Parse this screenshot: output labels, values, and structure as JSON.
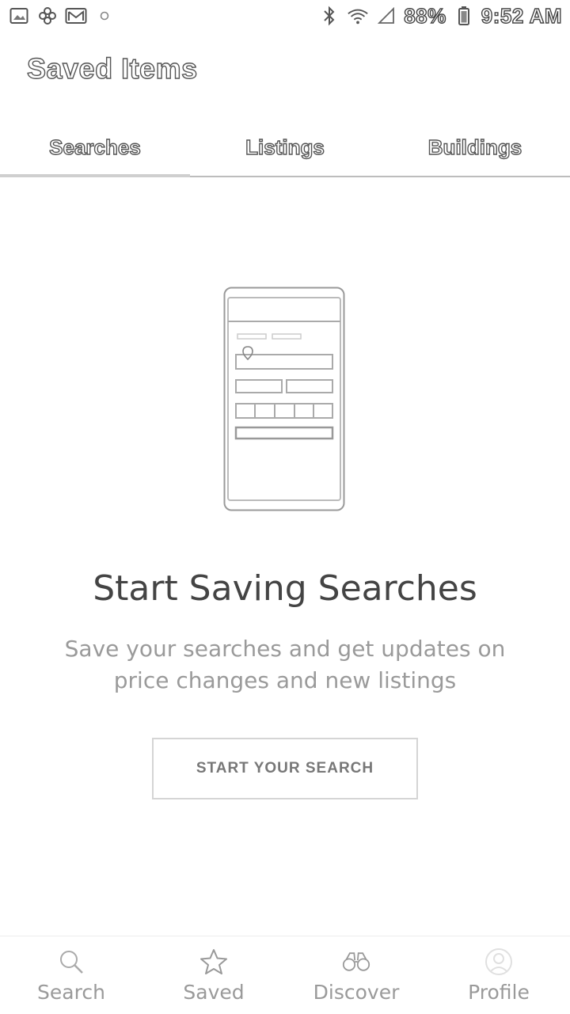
{
  "status_bar": {
    "battery": "88%",
    "time": "9:52 AM",
    "icons_left": [
      "image-icon",
      "pinwheel-icon",
      "mail-icon",
      "dot-icon"
    ],
    "icons_right": [
      "bluetooth-icon",
      "wifi-icon",
      "signal-icon",
      "battery-icon"
    ]
  },
  "header": {
    "title": "Saved Items"
  },
  "tabs": [
    {
      "label": "Searches",
      "active": true
    },
    {
      "label": "Listings",
      "active": false
    },
    {
      "label": "Buildings",
      "active": false
    }
  ],
  "empty_state": {
    "illustration": "phone-search-form-illustration",
    "headline": "Start Saving Searches",
    "subtitle": "Save your searches and get updates on price changes and new listings",
    "cta_label": "START YOUR SEARCH"
  },
  "bottom_nav": [
    {
      "label": "Search",
      "icon": "magnifier-icon"
    },
    {
      "label": "Saved",
      "icon": "star-icon"
    },
    {
      "label": "Discover",
      "icon": "binoculars-icon"
    },
    {
      "label": "Profile",
      "icon": "profile-icon"
    }
  ],
  "colors": {
    "background": "#ffffff",
    "divider": "#bdbdbd",
    "muted_text": "#9a9a9a",
    "heading_text": "#444444"
  }
}
